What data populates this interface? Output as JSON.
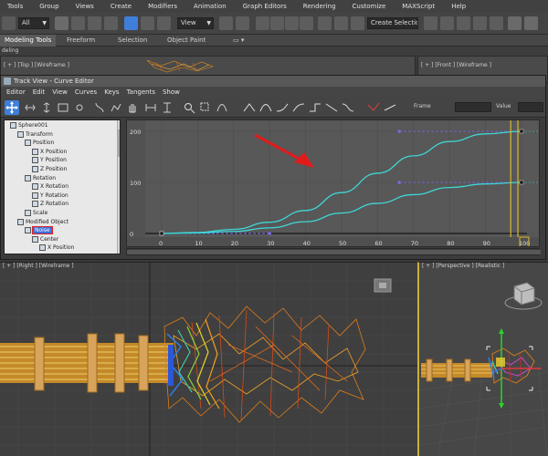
{
  "menubar": [
    "Tools",
    "Group",
    "Views",
    "Create",
    "Modifiers",
    "Animation",
    "Graph Editors",
    "Rendering",
    "Customize",
    "MAXScript",
    "Help"
  ],
  "toolbar": {
    "selection_filter": "All",
    "reference_coord": "View",
    "named_selection": "Create Selection Se"
  },
  "ribbon": {
    "tabs": [
      "Modeling Tools",
      "Freeform",
      "Selection",
      "Object Paint"
    ],
    "sub_label": "deling"
  },
  "viewports": {
    "top_label": "[ + ] [Top ] [Wireframe ]",
    "front_label": "[ + ] [Front ] [Wireframe ]",
    "left_label": "[ + ] [Right ] [Wireframe ]",
    "persp_label": "[ + ] [Perspective ] [Realistic ]"
  },
  "trackview": {
    "title": "Track View - Curve Editor",
    "menu": [
      "Editor",
      "Edit",
      "View",
      "Curves",
      "Keys",
      "Tangents",
      "Show"
    ],
    "frame_label": "Frame",
    "value_label": "Value",
    "tree": [
      {
        "label": "Sphere001",
        "indent": 0
      },
      {
        "label": "Transform",
        "indent": 1
      },
      {
        "label": "Position",
        "indent": 2
      },
      {
        "label": "X Position",
        "indent": 3
      },
      {
        "label": "Y Position",
        "indent": 3
      },
      {
        "label": "Z Position",
        "indent": 3
      },
      {
        "label": "Rotation",
        "indent": 2
      },
      {
        "label": "X Rotation",
        "indent": 3
      },
      {
        "label": "Y Rotation",
        "indent": 3
      },
      {
        "label": "Z Rotation",
        "indent": 3
      },
      {
        "label": "Scale",
        "indent": 2
      },
      {
        "label": "Modified Object",
        "indent": 1
      },
      {
        "label": "Noise",
        "indent": 2,
        "selected": true
      },
      {
        "label": "Center",
        "indent": 3
      },
      {
        "label": "X Position",
        "indent": 4
      }
    ]
  },
  "chart_data": {
    "type": "line",
    "x_ticks": [
      "0",
      "10",
      "20",
      "30",
      "40",
      "50",
      "60",
      "70",
      "80",
      "90",
      "100"
    ],
    "y_ticks": [
      "200",
      "100",
      "0"
    ],
    "xlim": [
      0,
      100
    ],
    "ylim": [
      0,
      200
    ],
    "series": [
      {
        "x": [
          0,
          10,
          20,
          30,
          40,
          50,
          60,
          70,
          80,
          90,
          100
        ],
        "y": [
          0,
          2,
          8,
          22,
          45,
          80,
          118,
          152,
          180,
          195,
          200
        ]
      },
      {
        "x": [
          0,
          10,
          20,
          30,
          40,
          50,
          60,
          70,
          80,
          90,
          100
        ],
        "y": [
          0,
          1,
          4,
          11,
          23,
          40,
          59,
          76,
          90,
          97,
          100
        ]
      }
    ],
    "colors": {
      "curve": "#3fd7d7",
      "key_tangent": "#7a6cf0",
      "current_frame": "#d9b82a",
      "annotation": "#e01b1b"
    }
  }
}
